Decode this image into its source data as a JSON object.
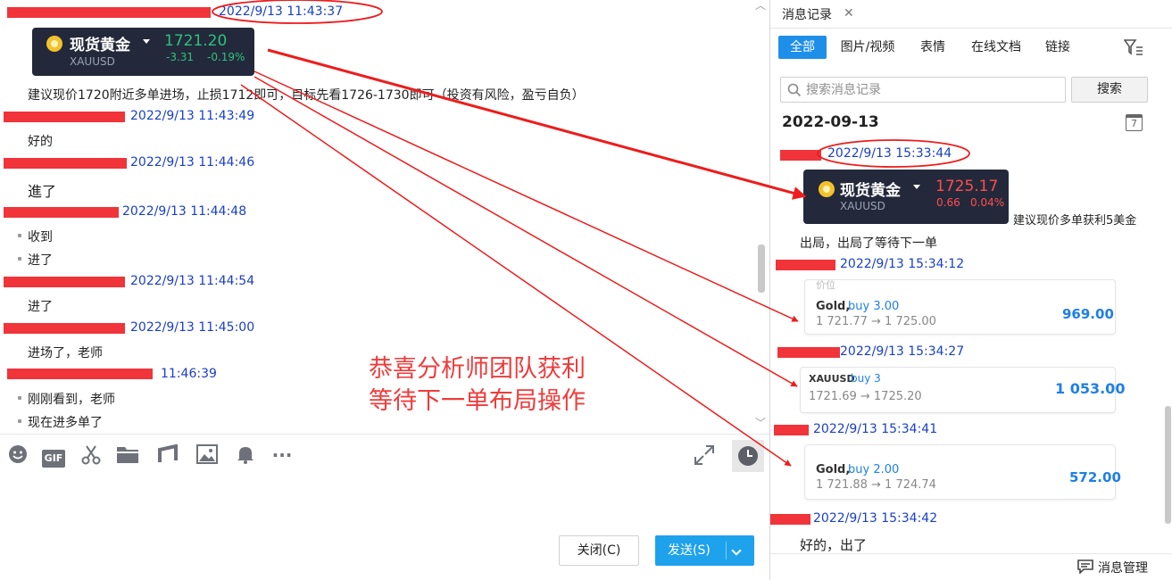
{
  "chat": {
    "quote_card": {
      "name": "现货黄金",
      "symbol": "XAUUSD",
      "price": "1721.20",
      "change": "-3.31",
      "change_pct": "-0.19%",
      "price_color": "#2ec27e"
    },
    "messages": [
      {
        "time": "2022/9/13 11:43:37",
        "lines": [
          "建议现价1720附近多单进场，止损1712即可，目标先看1726-1730即可（投资有风险，盈亏自负）"
        ]
      },
      {
        "time": "2022/9/13 11:43:49",
        "lines": [
          "好的"
        ]
      },
      {
        "time": "2022/9/13 11:44:46",
        "lines": [
          "進了"
        ]
      },
      {
        "time": "2022/9/13 11:44:48",
        "lines": [
          "收到",
          "进了"
        ]
      },
      {
        "time": "2022/9/13 11:44:54",
        "lines": [
          "进了"
        ]
      },
      {
        "time": "2022/9/13 11:45:00",
        "lines": [
          "进场了，老师"
        ]
      },
      {
        "time": "11:46:39",
        "lines": [
          "刚刚看到，老师",
          "现在进多单了"
        ]
      }
    ],
    "annotation": [
      "恭喜分析师团队获利",
      "等待下一单布局操作"
    ],
    "toolbar": {
      "icons": [
        "emoji-icon",
        "gif-icon",
        "scissors-icon",
        "folder-icon",
        "music-note-icon",
        "image-icon",
        "bell-icon",
        "more-icon"
      ],
      "gif_label": "GIF",
      "more_label": "···"
    },
    "close_label": "关闭(C)",
    "send_label": "发送(S)"
  },
  "history": {
    "panel_tab": "消息记录",
    "filter_tabs": [
      "全部",
      "图片/视频",
      "表情",
      "在线文档",
      "链接"
    ],
    "search_placeholder": "搜索消息记录",
    "search_button": "搜索",
    "date": "2022-09-13",
    "calendar_day": "7",
    "quote_card": {
      "name": "现货黄金",
      "symbol": "XAUUSD",
      "price": "1725.17",
      "change": "0.66",
      "change_pct": "0.04%",
      "price_color": "#ff4d4f"
    },
    "entries": [
      {
        "time": "2022/9/13 15:33:44",
        "text": "建议现价多单获利5美金",
        "text2": "出局，出局了等待下一单"
      },
      {
        "time": "2022/9/13 15:34:12",
        "trade": {
          "symbol": "Gold,",
          "action": "buy 3.00",
          "prices": "1 721.77 → 1 725.00",
          "profit": "969.00",
          "crop_label": "价位"
        }
      },
      {
        "time": "2022/9/13 15:34:27",
        "trade": {
          "symbol": "XAUUSD",
          "action": "buy 3",
          "prices": "1721.69 → 1725.20",
          "profit": "1 053.00"
        }
      },
      {
        "time": "2022/9/13 15:34:41",
        "trade": {
          "symbol": "Gold,",
          "action": "buy 2.00",
          "prices": "1 721.88 → 1 724.74",
          "profit": "572.00"
        }
      },
      {
        "time": "2022/9/13 15:34:42",
        "text": "好的，出了"
      }
    ],
    "footer_label": "消息管理"
  }
}
